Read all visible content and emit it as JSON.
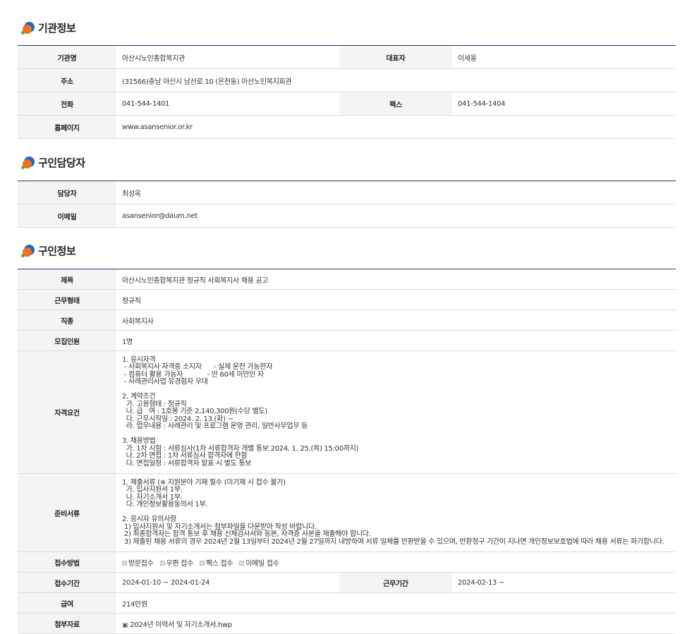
{
  "sections": {
    "org": "기관정보",
    "contact": "구인담당자",
    "job": "구인정보"
  },
  "org": {
    "name_label": "기관명",
    "name": "아산시노인종합복지관",
    "ceo_label": "대표자",
    "ceo": "이세웅",
    "addr_label": "주소",
    "addr": "(31566)충남 아산시 남산로 10 (온천동) 아산노인복지회관",
    "tel_label": "전화",
    "tel": "041-544-1401",
    "fax_label": "팩스",
    "fax": "041-544-1404",
    "home_label": "홈페이지",
    "home": "www.asansenior.or.kr"
  },
  "contact": {
    "person_label": "담당자",
    "person": "최성욱",
    "email_label": "이메일",
    "email": "asansenior@daum.net"
  },
  "job": {
    "title_label": "제목",
    "title": "아산시노인종합복지관 정규직 사회복지사 채용 공고",
    "type_label": "근무형태",
    "type": "정규직",
    "kind_label": "직종",
    "kind": "사회복지사",
    "count_label": "모집인원",
    "count": "1명",
    "qual_label": "자격요건",
    "qual": "1. 응시자격\n - 사회복지사 자격증 소지자      - 실제 운전 가능한자\n - 컴퓨터 활용 가능자            - 만 60세 미만인 자\n - 사례관리사업 유경험자 우대\n\n2. 계약조건\n  가. 고용형태 : 정규직\n  나. 급   여 : 1호봉 기준 2,140,300원(수당 별도)\n  다. 근무시작일 : 2024. 2. 13.(화) ~\n  라. 업무내용 : 사례관리 및 프로그램 운영 관리, 일반사무업무 등\n\n3. 채용방법\n  가. 1차 시험 : 서류심사(1차 서류합격자 개별 통보 2024. 1. 25.(목) 15:00까지)\n  나. 2차 면접 : 1차 서류심사 합격자에 한함\n  다. 면접일정 : 서류합격자 발표 시 별도 통보",
    "docs_label": "준비서류",
    "docs": "1. 제출서류 (※ 지원분야 기재 필수 (미기재 시 접수 불가)\n  가. 입사지원서 1부.\n  나. 자기소개서 1부.\n  다. 개인정보활용동의서 1부.\n\n2. 응시자 유의사항\n 1) 입사지원서 및 자기소개서는 첨부파일을 다운받아 작성 바랍니다.\n 2) 최종합격자는 합격 통보 후 채용 신체검사서와 등본, 자격증 사본을 제출해야 합니다.\n 3) 제출된 채용 서류의 경우 2024년 2월 13일부터 2024년 2월 27일까지 내방하여 서류 일체를 반환받을 수 있으며, 반환청구 기간이 지나면 개인정보보호법에 따라 채용 서류는 파기합니다.",
    "method_label": "접수방법",
    "methods": [
      "방문접수",
      "우편 접수",
      "팩스 접수",
      "이메일 접수"
    ],
    "period_label": "접수기간",
    "period": "2024-01-10 ~ 2024-01-24",
    "workperiod_label": "근무기간",
    "workperiod": "2024-02-13 ~",
    "salary_label": "급여",
    "salary": "214만원",
    "attach_label": "첨부자료",
    "attach": "2024년 이력서 및 자기소개서.hwp"
  }
}
